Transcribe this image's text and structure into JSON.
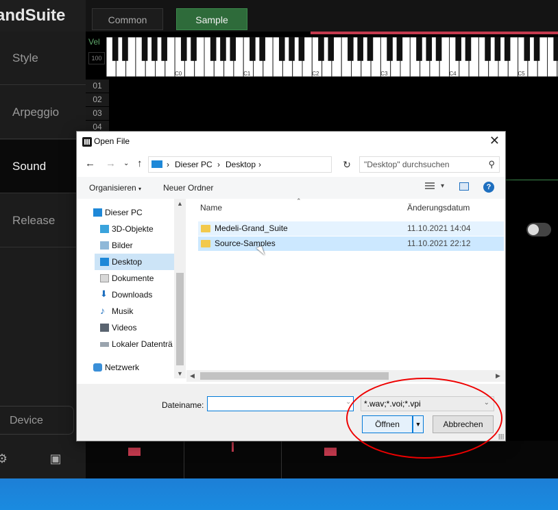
{
  "app": {
    "brand": "andSuite",
    "tabs": [
      "Common",
      "Sample"
    ],
    "active_tab": "Sample",
    "sidebar": [
      "Style",
      "Arpeggio",
      "Sound",
      "Release"
    ],
    "active_sidebar": "Sound",
    "device_label": "Device",
    "vel_label": "Vel",
    "vel_value": "100",
    "octaves": [
      "C0",
      "C1",
      "C2",
      "C3",
      "C4",
      "C5"
    ],
    "rows": [
      "01",
      "02",
      "03",
      "04"
    ]
  },
  "dialog": {
    "title": "Open File",
    "breadcrumb": [
      "Dieser PC",
      "Desktop"
    ],
    "search_placeholder": "\"Desktop\" durchsuchen",
    "organize_label": "Organisieren",
    "new_folder_label": "Neuer Ordner",
    "tree": [
      {
        "label": "Dieser PC",
        "icon": "pc-icon"
      },
      {
        "label": "3D-Objekte",
        "icon": "cube-icon"
      },
      {
        "label": "Bilder",
        "icon": "pictures-icon"
      },
      {
        "label": "Desktop",
        "icon": "desktop-icon"
      },
      {
        "label": "Dokumente",
        "icon": "documents-icon"
      },
      {
        "label": "Downloads",
        "icon": "download-icon"
      },
      {
        "label": "Musik",
        "icon": "music-icon"
      },
      {
        "label": "Videos",
        "icon": "video-icon"
      },
      {
        "label": "Lokaler Datenträ",
        "icon": "drive-icon"
      },
      {
        "label": "Netzwerk",
        "icon": "network-icon"
      }
    ],
    "selected_tree": "Desktop",
    "columns": {
      "name": "Name",
      "date": "Änderungsdatum"
    },
    "files": [
      {
        "name": "Medeli-Grand_Suite",
        "date": "11.10.2021 14:04"
      },
      {
        "name": "Source-Samples",
        "date": "11.10.2021 22:12"
      }
    ],
    "filename_label": "Dateiname:",
    "filename_value": "",
    "filter_value": "*.wav;*.voi;*.vpi",
    "open_label": "Öffnen",
    "cancel_label": "Abbrechen"
  },
  "colors": {
    "accent_green": "#2e6b3a",
    "accent_red": "#c43a4e",
    "win_blue": "#0078d7",
    "annotation_red": "#e00000"
  }
}
